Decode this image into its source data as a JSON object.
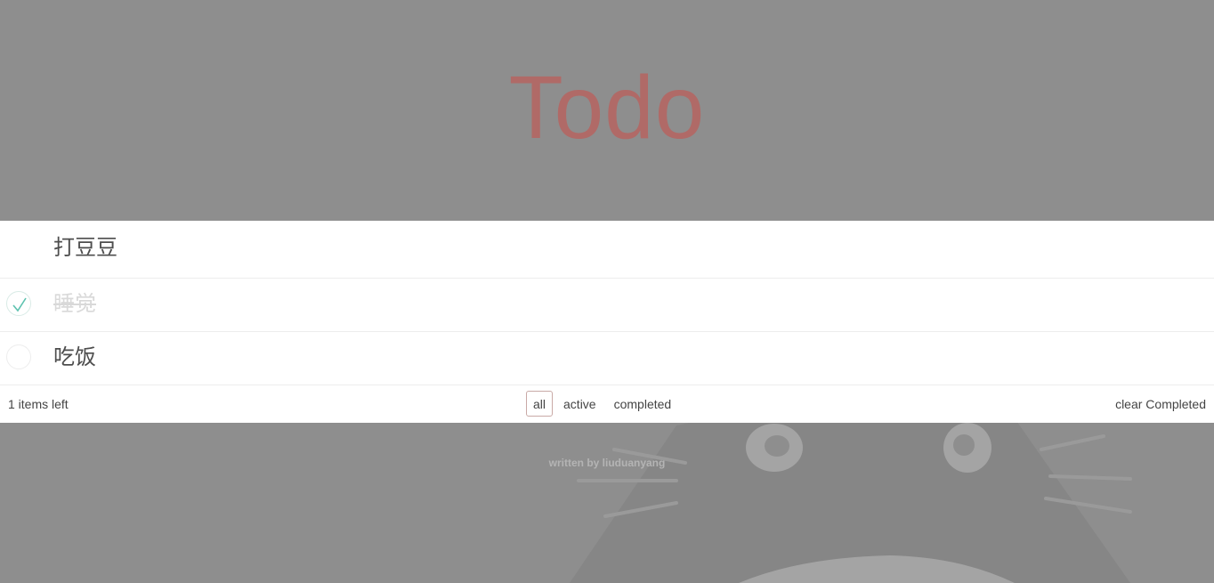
{
  "header": {
    "title": "Todo"
  },
  "todos": [
    {
      "label": "打豆豆",
      "completed": false,
      "toggle_visible": false
    },
    {
      "label": "睡觉",
      "completed": true,
      "toggle_visible": true
    },
    {
      "label": "吃饭",
      "completed": false,
      "toggle_visible": true
    }
  ],
  "footer": {
    "items_left": "1 items left",
    "filters": [
      "all",
      "active",
      "completed"
    ],
    "selected_filter": "all",
    "clear_label": "clear Completed"
  },
  "credit": "written by liuduanyang",
  "colors": {
    "background": "#8e8e8e",
    "title": "#b06a67",
    "check": "#5dc2af",
    "selected_border": "#c9a9a6"
  },
  "icons": {
    "check": "check-icon",
    "background": "totoro-illustration"
  }
}
